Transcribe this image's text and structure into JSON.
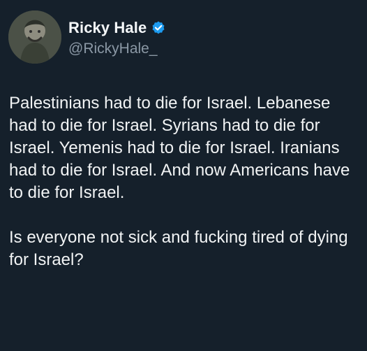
{
  "author": {
    "display_name": "Ricky Hale",
    "handle": "@RickyHale_",
    "verified": true,
    "verified_icon": "verified-badge-icon",
    "avatar_icon": "profile-avatar-icon"
  },
  "tweet": {
    "paragraphs": [
      "Palestinians had to die for Israel. Lebanese had to die for Israel. Syrians had to die for Israel. Yemenis had to die for Israel. Iranians had to die for Israel. And now Americans have to die for Israel.",
      "Is everyone not sick and fucking tired of dying for Israel?"
    ]
  },
  "colors": {
    "background": "#15202b",
    "text": "#e7e9ea",
    "secondary_text": "#8b98a5",
    "verified_blue": "#1d9bf0"
  }
}
